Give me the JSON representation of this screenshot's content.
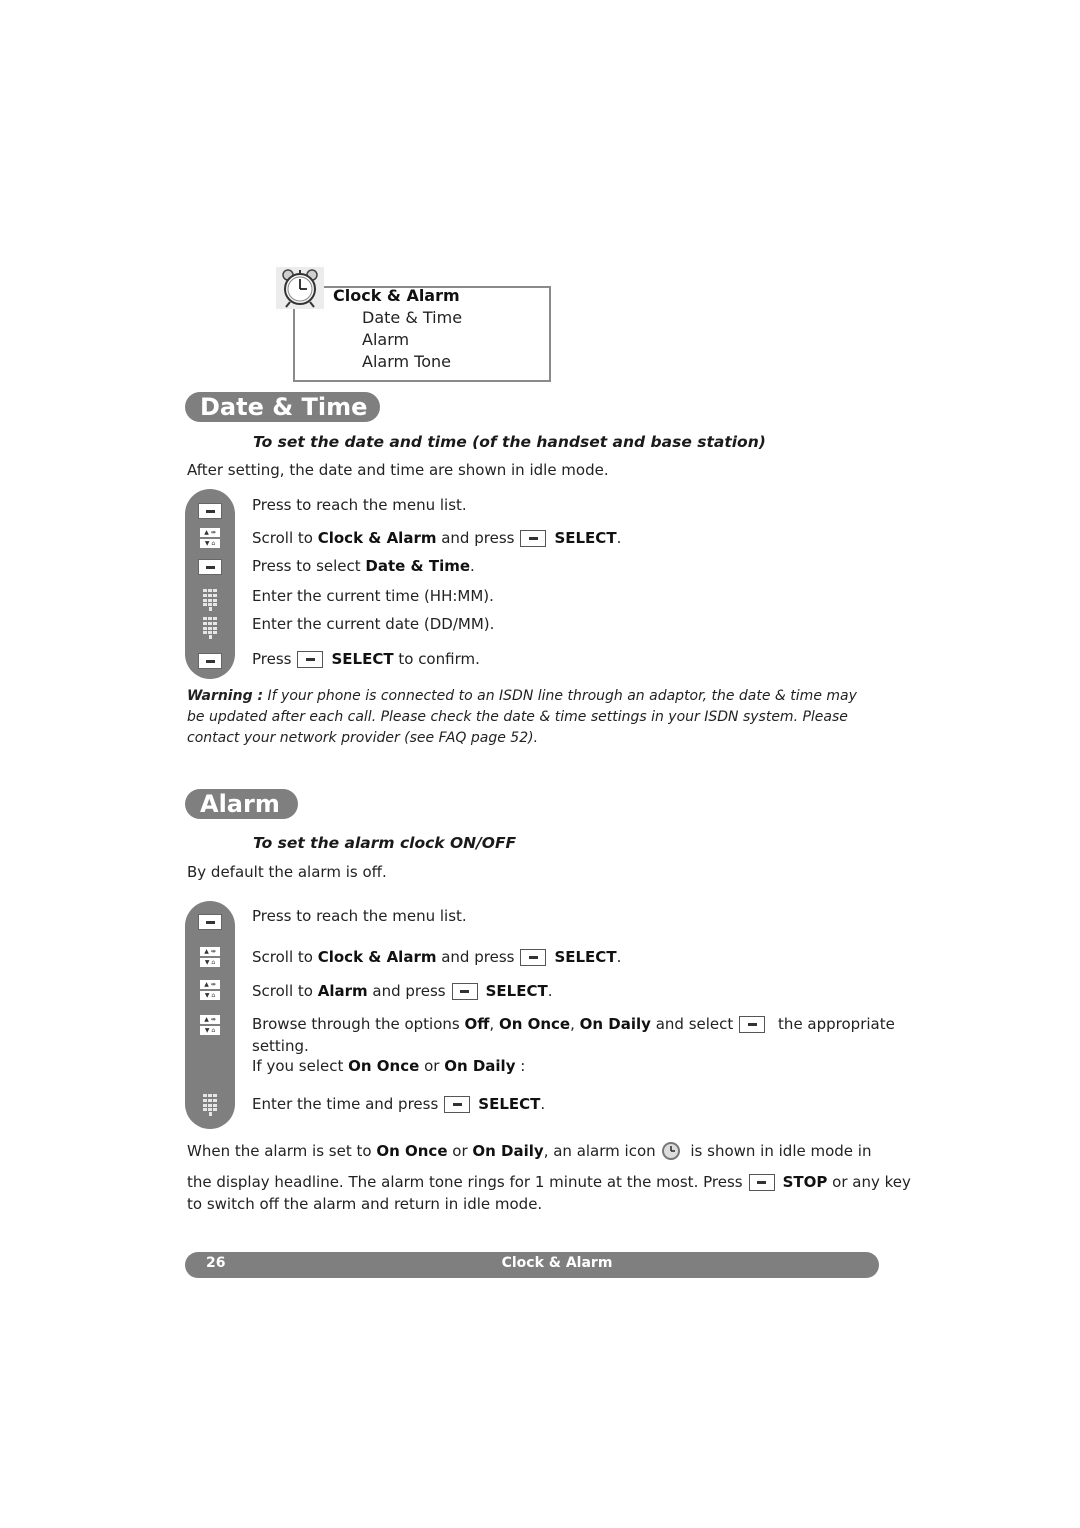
{
  "menu": {
    "title": "Clock & Alarm",
    "items": [
      "Date & Time",
      "Alarm",
      "Alarm Tone"
    ]
  },
  "date_time": {
    "header": "Date & Time",
    "subhead": "To set the date and time (of the handset and base station)",
    "intro": "After setting, the date and time are shown in idle mode.",
    "steps": [
      {
        "icon": "menu-key-icon",
        "text": "Press to reach the menu list."
      },
      {
        "icon": "nav-key-icon",
        "pre": "Scroll to ",
        "bold": "Clock & Alarm",
        "mid": " and press",
        "action": "SELECT",
        "post": "."
      },
      {
        "icon": "menu-key-icon",
        "pre": "Press to select ",
        "bold": "Date & Time",
        "post": "."
      },
      {
        "icon": "keypad-icon",
        "text": "Enter the current time (HH:MM)."
      },
      {
        "icon": "keypad-icon",
        "text": "Enter the current date (DD/MM)."
      },
      {
        "icon": "menu-key-icon",
        "pre": "Press",
        "action": "SELECT",
        "post": " to confirm."
      }
    ],
    "warning_label": "Warning :",
    "warning_text": " If your phone is connected to an ISDN line through an adaptor, the date & time may be updated after each call. Please check the date & time settings in your ISDN system. Please contact your network provider (see FAQ page 52)."
  },
  "alarm": {
    "header": "Alarm",
    "subhead": "To set the alarm clock ON/OFF",
    "intro": "By default the alarm is off.",
    "steps": [
      {
        "icon": "menu-key-icon",
        "text": "Press to reach the menu list."
      },
      {
        "icon": "nav-key-icon",
        "pre": "Scroll to ",
        "bold": "Clock & Alarm",
        "mid": " and press",
        "action": "SELECT",
        "post": "."
      },
      {
        "icon": "nav-key-icon",
        "pre": "Scroll to ",
        "bold": "Alarm",
        "mid": " and press",
        "action": "SELECT",
        "post": "."
      },
      {
        "icon": "nav-key-icon",
        "pre": "Browse through the options ",
        "opt1": "Off",
        "opt2": "On Once",
        "opt3": "On Daily",
        "mid": " and select",
        "post": " the appropriate",
        "line2": "setting.",
        "line3_pre": "If you select ",
        "line3_b1": "On Once",
        "line3_mid": " or ",
        "line3_b2": "On Daily",
        "line3_post": " :"
      },
      {
        "icon": "keypad-icon",
        "pre": "Enter the time and press",
        "action": "SELECT",
        "post": "."
      }
    ],
    "note": {
      "p1_pre": "When the alarm is set to ",
      "p1_b1": "On Once",
      "p1_mid": " or ",
      "p1_b2": "On Daily",
      "p1_post1": ", an alarm icon",
      "p1_post2": " is shown in idle mode in",
      "p2_pre": "the display headline. The alarm tone rings for 1 minute at the most. Press",
      "p2_action": "STOP",
      "p2_post": " or any key",
      "p3": "to switch off the alarm and return in idle mode."
    }
  },
  "footer": {
    "page_number": "26",
    "section": "Clock & Alarm"
  }
}
